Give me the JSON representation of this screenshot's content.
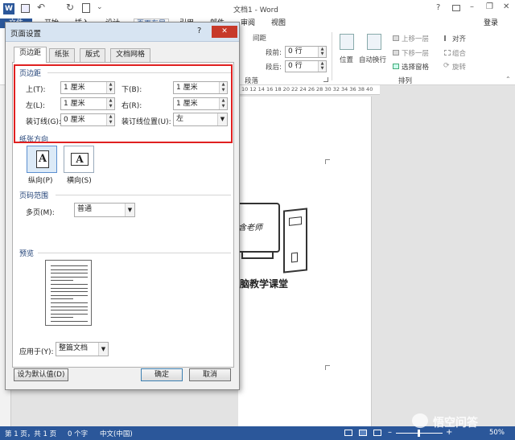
{
  "window": {
    "title": "文档1 - Word",
    "help": "?",
    "min": "–",
    "restore": "❐",
    "close": "✕",
    "login": "登录"
  },
  "tabs": [
    "文件",
    "开始",
    "插入",
    "设计",
    "页面布局",
    "引用",
    "邮件",
    "审阅",
    "视图"
  ],
  "ribbon": {
    "spacing_label": "间距",
    "before_label": "段前:",
    "before_value": "0 行",
    "after_label": "段后:",
    "after_value": "0 行",
    "paragraph_group": "段落",
    "position": "位置",
    "wrap": "自动换行",
    "bring_forward": "上移一层",
    "send_backward": "下移一层",
    "selection_pane": "选择窗格",
    "align": "对齐",
    "group": "组合",
    "rotate": "旋转",
    "arrange_group": "排列"
  },
  "ruler": "10 12 14 16 18 20 22 24 26 28 30 32 34 36 38 40",
  "doc": {
    "caption": "脑教学课堂",
    "monitor_text": "含老师"
  },
  "status": {
    "page": "第 1 页，共 1 页",
    "words": "0 个字",
    "lang": "中文(中国)",
    "zoom": "50%",
    "watermark": "悟空问答"
  },
  "dialog": {
    "title": "页面设置",
    "help": "?",
    "close": "✕",
    "tabs": [
      "页边距",
      "纸张",
      "版式",
      "文档网格"
    ],
    "margins_section": "页边距",
    "top_label": "上(T):",
    "top_value": "1 厘米",
    "bottom_label": "下(B):",
    "bottom_value": "1 厘米",
    "left_label": "左(L):",
    "left_value": "1 厘米",
    "right_label": "右(R):",
    "right_value": "1 厘米",
    "gutter_label": "装订线(G):",
    "gutter_value": "0 厘米",
    "gutter_pos_label": "装订线位置(U):",
    "gutter_pos_value": "左",
    "orientation_section": "纸张方向",
    "portrait": "纵向(P)",
    "landscape": "横向(S)",
    "pages_section": "页码范围",
    "multiple_label": "多页(M):",
    "multiple_value": "普通",
    "preview_section": "预览",
    "apply_label": "应用于(Y):",
    "apply_value": "整篇文档",
    "default_btn": "设为默认值(D)",
    "ok_btn": "确定",
    "cancel_btn": "取消"
  },
  "colors": {
    "accent": "#2b579a",
    "highlight": "#e02020"
  }
}
